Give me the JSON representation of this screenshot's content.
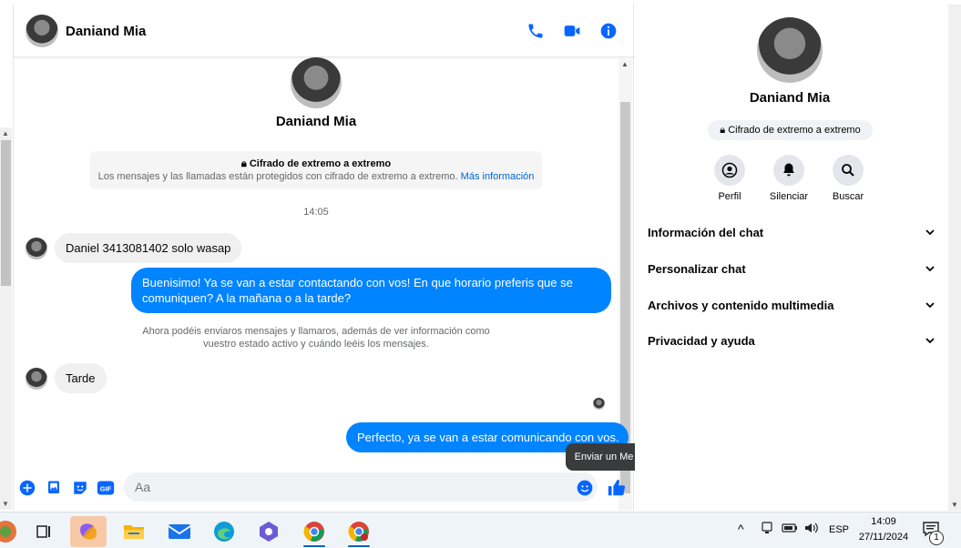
{
  "contact": {
    "name": "Daniand Mia"
  },
  "header": {
    "call_icon": "phone-icon",
    "video_icon": "video-icon",
    "info_icon": "info-icon"
  },
  "e2e": {
    "title": "Cifrado de extremo a extremo",
    "description": "Los mensajes y las llamadas están protegidos con cifrado de extremo a extremo.",
    "link": "Más información"
  },
  "conversation": {
    "timestamp": "14:05",
    "msg1": "Daniel 3413081402 solo wasap",
    "msg2_line1": "Buenisimo! Ya se van a estar contactando con vos! En que horario preferis que se",
    "msg2_line2": "comuniquen? A la mañana o a la tarde?",
    "system_line1": "Ahora podéis enviaros mensajes y llamaros, además de ver información como",
    "system_line2": "vuestro estado activo y cuándo leéis los mensajes.",
    "msg3": "Tarde",
    "msg4": "Perfecto, ya se van a estar comunicando con vos."
  },
  "composer": {
    "placeholder": "Aa",
    "tooltip": "Enviar un Me gusta",
    "gif_label": "GIF"
  },
  "info_panel": {
    "name": "Daniand Mia",
    "e2e_badge": "Cifrado de extremo a extremo",
    "actions": {
      "profile": "Perfil",
      "mute": "Silenciar",
      "search": "Buscar"
    },
    "sections": {
      "chat_info": "Información del chat",
      "customize": "Personalizar chat",
      "media": "Archivos y contenido multimedia",
      "privacy": "Privacidad y ayuda"
    }
  },
  "taskbar": {
    "lang": "ESP",
    "time": "14:09",
    "date": "27/11/2024",
    "notif_count": "1"
  },
  "colors": {
    "accent": "#0084ff",
    "icon_blue": "#0866ff"
  }
}
